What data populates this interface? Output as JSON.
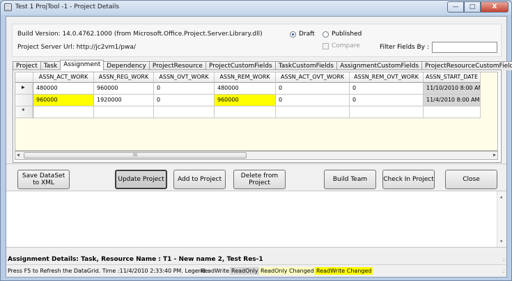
{
  "window": {
    "title": "Test 1 ProjTool -1  -  Project Details",
    "icon": "app-window-icon",
    "controls": {
      "minimize": "—",
      "maximize": "□",
      "close": "X"
    }
  },
  "info": {
    "build_version": "Build Version: 14.0.4762.1000  (from Microsoft.Office.Project.Server.Library.dll)",
    "server_url": "Project Server Url: http://jc2vm1/pwa/",
    "radio_draft": "Draft",
    "radio_published": "Published",
    "selected_mode": "Draft",
    "compare_label": "Compare",
    "filter_label": "Filter Fields By :",
    "filter_value": ""
  },
  "tabs": [
    {
      "label": "Project"
    },
    {
      "label": "Task"
    },
    {
      "label": "Assignment",
      "active": true
    },
    {
      "label": "Dependency"
    },
    {
      "label": "ProjectResource"
    },
    {
      "label": "ProjectCustomFields"
    },
    {
      "label": "TaskCustomFields"
    },
    {
      "label": "AssignmentCustomFields"
    },
    {
      "label": "ProjectResourceCustomFields"
    }
  ],
  "grid": {
    "columns": [
      "ASSN_ACT_WORK",
      "ASSN_REG_WORK",
      "ASSN_OVT_WORK",
      "ASSN_REM_WORK",
      "ASSN_ACT_OVT_WORK",
      "ASSN_REM_OVT_WORK",
      "ASSN_START_DATE"
    ],
    "rows": [
      {
        "marker": "▸",
        "cells": [
          "480000",
          "960000",
          "0",
          "480000",
          "0",
          "0",
          "11/10/2010 8:00 AM"
        ]
      },
      {
        "marker": "",
        "cells": [
          "960000",
          "1920000",
          "0",
          "960000",
          "0",
          "0",
          "11/4/2010 8:00 AM"
        ]
      },
      {
        "marker": "*",
        "cells": [
          "",
          "",
          "",
          "",
          "",
          "",
          ""
        ]
      }
    ],
    "scroll_left": "◂",
    "scroll_right": "▸",
    "scroll_thumb": "III"
  },
  "buttons": {
    "save_dataset": "Save DataSet to XML",
    "update_project": "Update Project",
    "add_to_project": "Add to Project",
    "delete_from_project": "Delete from Project",
    "build_team": "Build Team",
    "check_in_project": "Check In Project",
    "close": "Close"
  },
  "lower_panel": {
    "scroll_up": "▴",
    "scroll_down": "▾"
  },
  "details": "Assignment Details: Task, Resource Name : T1 - New name 2, Test Res-1",
  "status": {
    "refresh": "Press F5 to Refresh the DataGrid.  Time :11/4/2010 2:33:40 PM.  Legend :",
    "legend_readwrite": "ReadWrite",
    "legend_readonly": "ReadOnly",
    "legend_readonly_changed": "ReadOnly Changed",
    "legend_readwrite_changed": "ReadWrite Changed"
  },
  "colors": {
    "changed_highlight": "#ffff00",
    "readonly_cell": "#d6d6d6",
    "grid_background": "#fffde8",
    "readonly_changed": "#ffffc0"
  }
}
